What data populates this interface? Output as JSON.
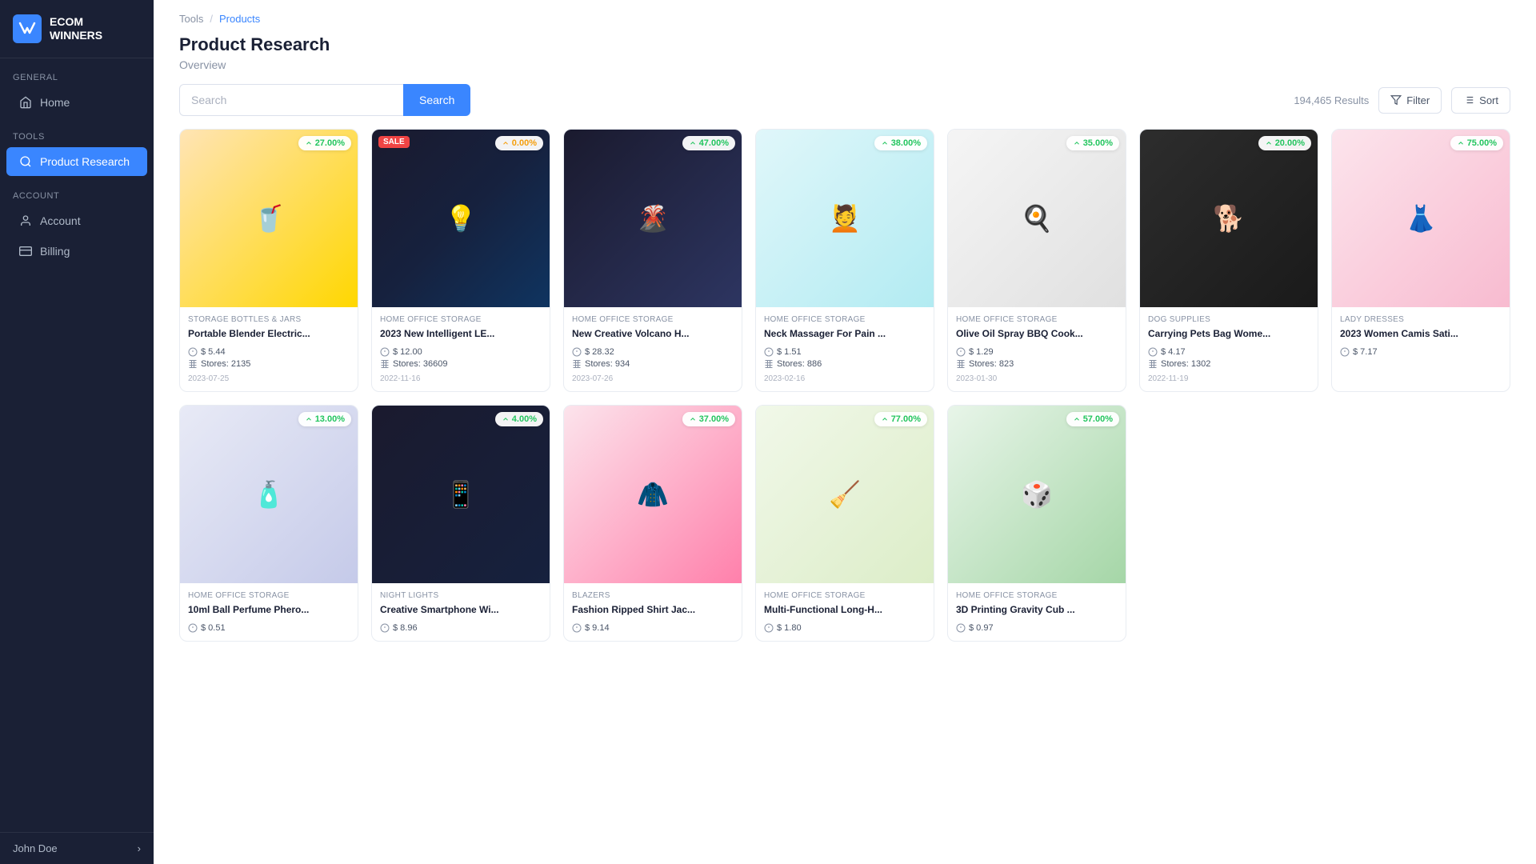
{
  "sidebar": {
    "logo": {
      "icon": "W",
      "brand": "ECOM\nWINNERS"
    },
    "sections": [
      {
        "label": "General",
        "items": [
          {
            "id": "home",
            "label": "Home",
            "icon": "home",
            "active": false
          }
        ]
      },
      {
        "label": "Tools",
        "items": [
          {
            "id": "product-research",
            "label": "Product Research",
            "icon": "search",
            "active": true
          }
        ]
      },
      {
        "label": "Account",
        "items": [
          {
            "id": "account",
            "label": "Account",
            "icon": "user",
            "active": false
          },
          {
            "id": "billing",
            "label": "Billing",
            "icon": "billing",
            "active": false
          }
        ]
      }
    ],
    "user": {
      "name": "John Doe",
      "chevron": "›"
    }
  },
  "breadcrumb": {
    "items": [
      "Tools",
      "Products"
    ]
  },
  "page": {
    "title": "Product Research",
    "subtitle": "Overview"
  },
  "toolbar": {
    "search_placeholder": "Search",
    "search_button_label": "Search",
    "results_count": "194,465 Results",
    "filter_label": "Filter",
    "sort_label": "Sort"
  },
  "products": [
    {
      "id": 1,
      "category": "Storage Bottles & Jars",
      "name": "Portable Blender Electric...",
      "price": "$ 5.44",
      "stores": "Stores: 2135",
      "date": "2023-07-25",
      "badge": "27.00%",
      "badge_type": "up",
      "bg": "img-bg-1",
      "emoji": "🥤",
      "sale": false
    },
    {
      "id": 2,
      "category": "Home Office Storage",
      "name": "2023 New Intelligent LE...",
      "price": "$ 12.00",
      "stores": "Stores: 36609",
      "date": "2022-11-16",
      "badge": "0.00%",
      "badge_type": "zero",
      "bg": "img-bg-2",
      "emoji": "💡",
      "sale": true
    },
    {
      "id": 3,
      "category": "Home Office Storage",
      "name": "New Creative Volcano H...",
      "price": "$ 28.32",
      "stores": "Stores: 934",
      "date": "2023-07-26",
      "badge": "47.00%",
      "badge_type": "up",
      "bg": "img-bg-3",
      "emoji": "🌋",
      "sale": false
    },
    {
      "id": 4,
      "category": "Home Office Storage",
      "name": "Neck Massager For Pain ...",
      "price": "$ 1.51",
      "stores": "Stores: 886",
      "date": "2023-02-16",
      "badge": "38.00%",
      "badge_type": "up",
      "bg": "img-bg-4",
      "emoji": "💆",
      "sale": false
    },
    {
      "id": 5,
      "category": "Home Office Storage",
      "name": "Olive Oil Spray BBQ Cook...",
      "price": "$ 1.29",
      "stores": "Stores: 823",
      "date": "2023-01-30",
      "badge": "35.00%",
      "badge_type": "up",
      "bg": "img-bg-5",
      "emoji": "🍳",
      "sale": false
    },
    {
      "id": 6,
      "category": "Dog Supplies",
      "name": "Carrying Pets Bag Wome...",
      "price": "$ 4.17",
      "stores": "Stores: 1302",
      "date": "2022-11-19",
      "badge": "20.00%",
      "badge_type": "up",
      "bg": "img-bg-6",
      "emoji": "🐕",
      "sale": false
    },
    {
      "id": 7,
      "category": "Lady Dresses",
      "name": "2023 Women Camis Sati...",
      "price": "$ 7.17",
      "stores": "",
      "date": "",
      "badge": "75.00%",
      "badge_type": "up",
      "bg": "img-bg-7",
      "emoji": "👗",
      "sale": false
    },
    {
      "id": 8,
      "category": "Home Office Storage",
      "name": "10ml Ball Perfume Phero...",
      "price": "$ 0.51",
      "stores": "",
      "date": "",
      "badge": "13.00%",
      "badge_type": "up",
      "bg": "img-bg-8",
      "emoji": "🧴",
      "sale": false
    },
    {
      "id": 9,
      "category": "Night Lights",
      "name": "Creative Smartphone Wi...",
      "price": "$ 8.96",
      "stores": "",
      "date": "",
      "badge": "4.00%",
      "badge_type": "up",
      "bg": "img-bg-9",
      "emoji": "📱",
      "sale": false
    },
    {
      "id": 10,
      "category": "Blazers",
      "name": "Fashion Ripped Shirt Jac...",
      "price": "$ 9.14",
      "stores": "",
      "date": "",
      "badge": "37.00%",
      "badge_type": "up",
      "bg": "img-bg-10",
      "emoji": "🧥",
      "sale": false
    },
    {
      "id": 11,
      "category": "Home Office Storage",
      "name": "Multi-Functional Long-H...",
      "price": "$ 1.80",
      "stores": "",
      "date": "",
      "badge": "77.00%",
      "badge_type": "up",
      "bg": "img-bg-11",
      "emoji": "🧹",
      "sale": false
    },
    {
      "id": 12,
      "category": "Home Office Storage",
      "name": "3D Printing Gravity Cub ...",
      "price": "$ 0.97",
      "stores": "",
      "date": "",
      "badge": "57.00%",
      "badge_type": "up",
      "bg": "img-bg-12",
      "emoji": "🎲",
      "sale": false
    }
  ]
}
